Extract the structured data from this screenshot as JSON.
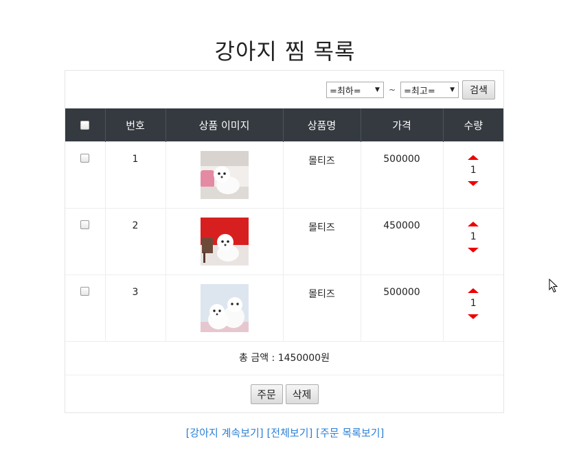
{
  "page": {
    "title": "강아지 찜 목록"
  },
  "search": {
    "min_select": "=최하=",
    "separator": "~",
    "max_select": "=최고=",
    "button": "검색"
  },
  "table": {
    "headers": [
      "번호",
      "상품 이미지",
      "상품명",
      "가격",
      "수량"
    ],
    "rows": [
      {
        "no": "1",
        "name": "몰티즈",
        "price": "500000",
        "qty": "1"
      },
      {
        "no": "2",
        "name": "몰티즈",
        "price": "450000",
        "qty": "1"
      },
      {
        "no": "3",
        "name": "몰티즈",
        "price": "500000",
        "qty": "1"
      }
    ]
  },
  "total": "총 금액 : 1450000원",
  "actions": {
    "order": "주문",
    "delete": "삭제"
  },
  "links": {
    "continue": "[강아지 계속보기]",
    "all": "[전체보기]",
    "orders": "[주문 목록보기]"
  },
  "colors": {
    "header_bg": "#343a40",
    "link": "#2a7fd4",
    "arrow": "#ee0000"
  }
}
